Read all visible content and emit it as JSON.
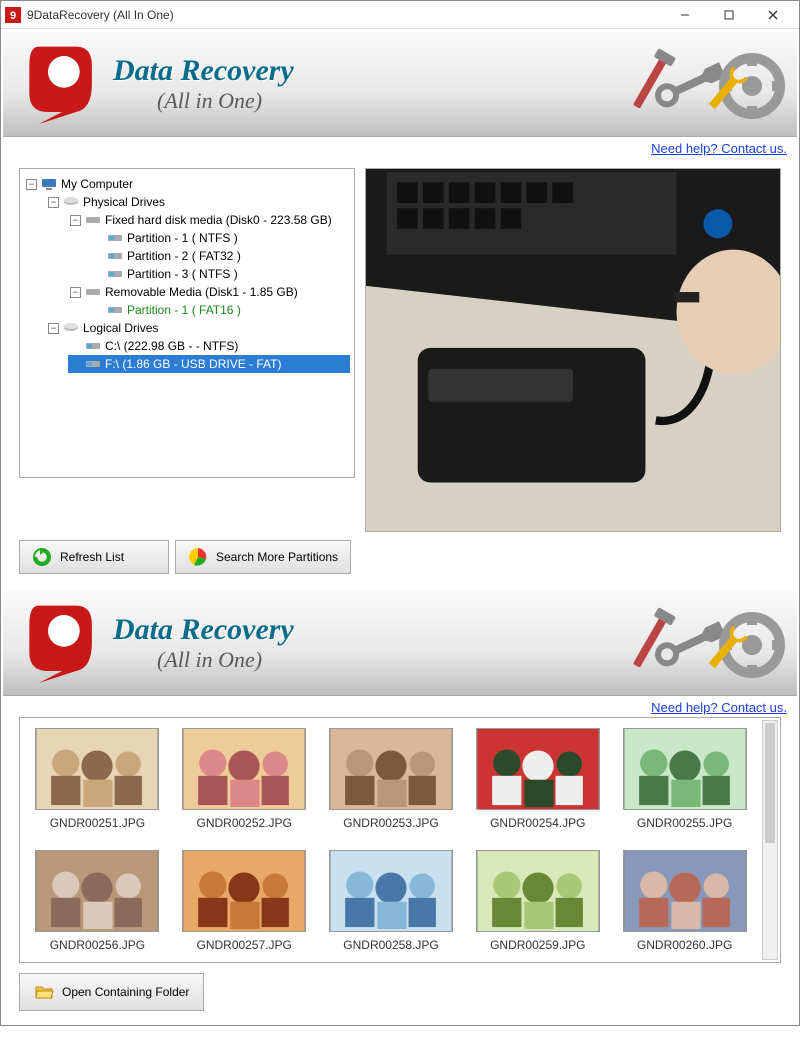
{
  "titlebar": {
    "title": "9DataRecovery (All In One)"
  },
  "banner": {
    "title": "Data Recovery",
    "subtitle": "(All in One)"
  },
  "help_link": "Need help? Contact us.",
  "tree": {
    "root": "My Computer",
    "physical_drives": "Physical Drives",
    "disk0": "Fixed hard disk media (Disk0 - 223.58 GB)",
    "p1": "Partition - 1 ( NTFS )",
    "p2": "Partition - 2 ( FAT32 )",
    "p3": "Partition - 3 ( NTFS )",
    "disk1": "Removable Media (Disk1 - 1.85 GB)",
    "p4": "Partition - 1 ( FAT16 )",
    "logical_drives": "Logical Drives",
    "c_drive": "C:\\ (222.98 GB -  - NTFS)",
    "f_drive": "F:\\ (1.86 GB - USB DRIVE - FAT)"
  },
  "buttons": {
    "refresh": "Refresh List",
    "search_more": "Search More Partitions",
    "open_folder": "Open Containing Folder"
  },
  "thumbs": [
    {
      "name": "GNDR00251.JPG"
    },
    {
      "name": "GNDR00252.JPG"
    },
    {
      "name": "GNDR00253.JPG"
    },
    {
      "name": "GNDR00254.JPG"
    },
    {
      "name": "GNDR00255.JPG"
    },
    {
      "name": "GNDR00256.JPG"
    },
    {
      "name": "GNDR00257.JPG"
    },
    {
      "name": "GNDR00258.JPG"
    },
    {
      "name": "GNDR00259.JPG"
    },
    {
      "name": "GNDR00260.JPG"
    }
  ]
}
